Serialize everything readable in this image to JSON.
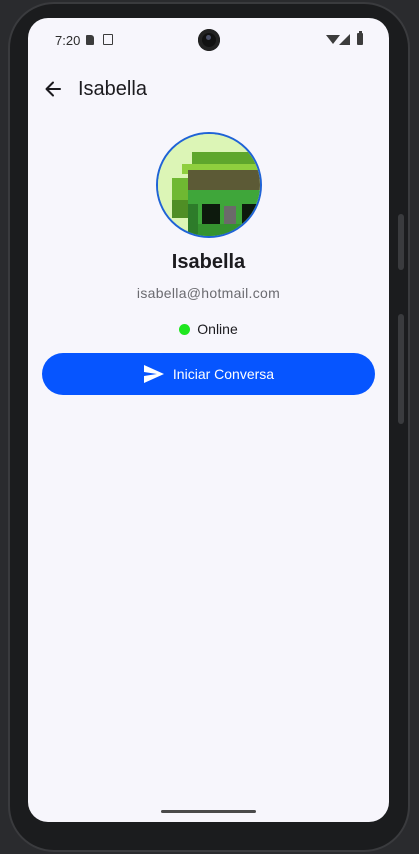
{
  "statusbar": {
    "time": "7:20",
    "icons": [
      "sd-card-icon",
      "copy-icon",
      "wifi-icon",
      "signal-icon",
      "battery-icon"
    ]
  },
  "appbar": {
    "back_icon": "arrow-left-icon",
    "title": "Isabella"
  },
  "profile": {
    "avatar": "pixel-art-avatar",
    "name": "Isabella",
    "email": "isabella@hotmail.com",
    "status_text": "Online",
    "status_color": "#1fe61f"
  },
  "actions": {
    "start_chat_label": "Iniciar Conversa",
    "start_chat_icon": "send-icon",
    "accent": "#0655ff"
  }
}
